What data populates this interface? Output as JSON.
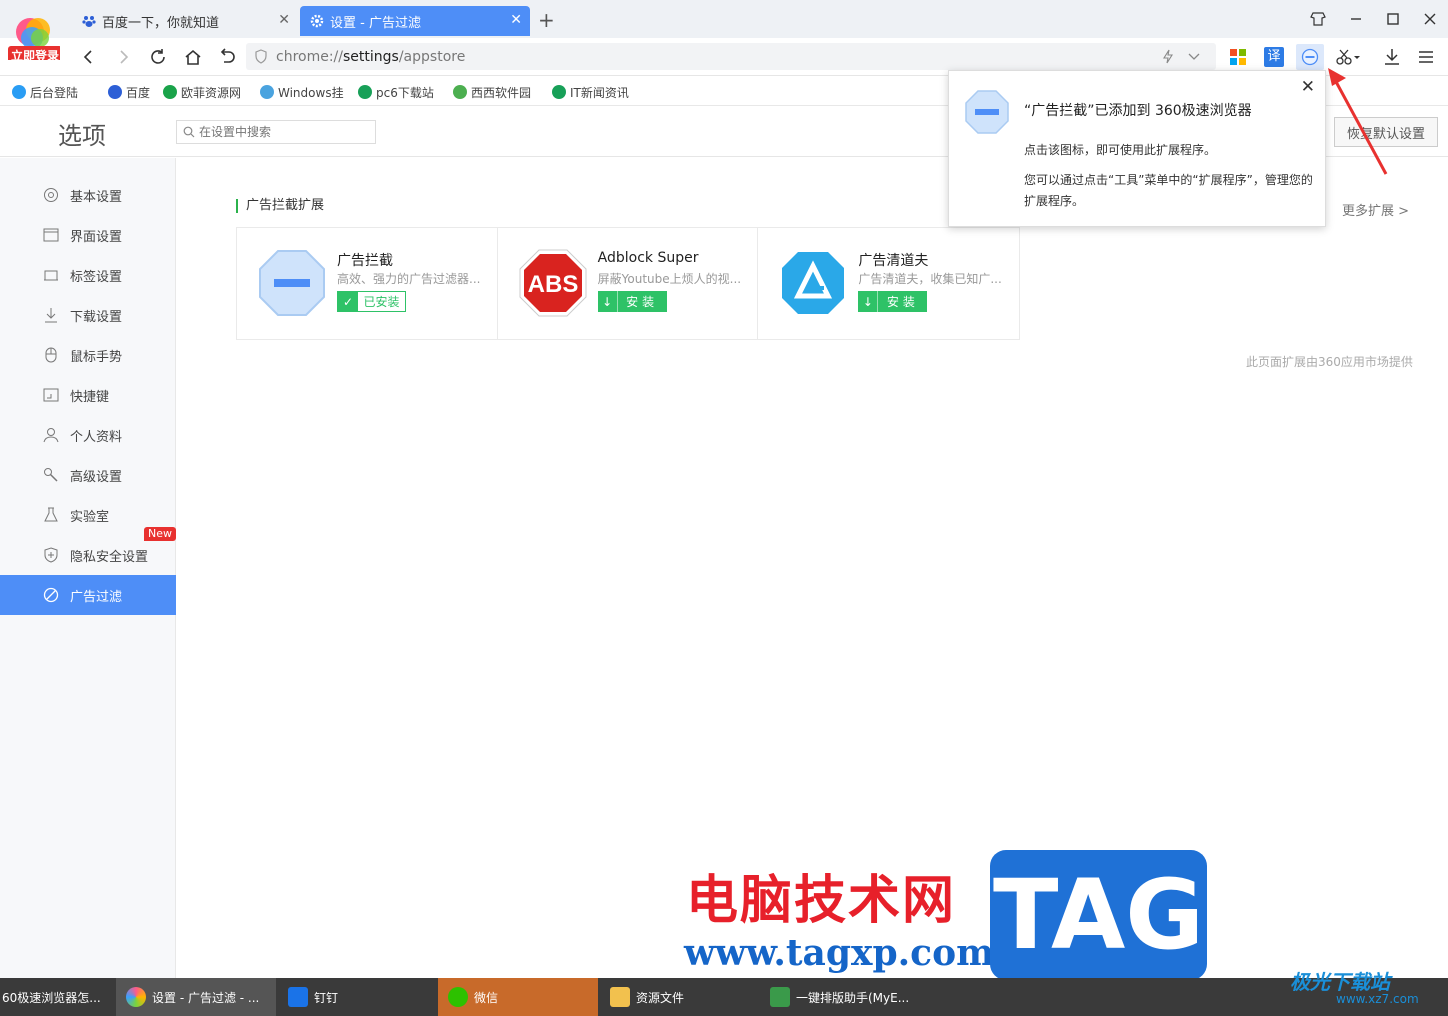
{
  "browser": {
    "login_badge": "立即登录",
    "tabs": [
      {
        "label": "百度一下，你就知道"
      },
      {
        "label": "设置 - 广告过滤"
      }
    ],
    "address": {
      "scheme": "chrome://",
      "host": "settings",
      "path": "/appstore"
    },
    "translate_label": "译"
  },
  "bookmarks": [
    {
      "label": "后台登陆"
    },
    {
      "label": "百度"
    },
    {
      "label": "欧菲资源网"
    },
    {
      "label": "Windows挂"
    },
    {
      "label": "pc6下载站"
    },
    {
      "label": "西西软件园"
    },
    {
      "label": "IT新闻资讯"
    }
  ],
  "settings": {
    "title": "选项",
    "search_placeholder": "在设置中搜索",
    "restore_label": "恢复默认设置",
    "new_badge": "New",
    "sidebar": [
      {
        "label": "基本设置",
        "icon": "gear-icon"
      },
      {
        "label": "界面设置",
        "icon": "window-icon"
      },
      {
        "label": "标签设置",
        "icon": "tab-icon"
      },
      {
        "label": "下载设置",
        "icon": "download-icon"
      },
      {
        "label": "鼠标手势",
        "icon": "mouse-icon"
      },
      {
        "label": "快捷键",
        "icon": "keyboard-icon"
      },
      {
        "label": "个人资料",
        "icon": "user-icon"
      },
      {
        "label": "高级设置",
        "icon": "wrench-icon"
      },
      {
        "label": "实验室",
        "icon": "flask-icon"
      },
      {
        "label": "隐私安全设置",
        "icon": "shield-icon"
      },
      {
        "label": "广告过滤",
        "icon": "block-icon",
        "active": true
      }
    ]
  },
  "main": {
    "section_title": "广告拦截扩展",
    "more_label": "更多扩展 >",
    "provider_note": "此页面扩展由360应用市场提供",
    "extensions": [
      {
        "name": "广告拦截",
        "desc": "高效、强力的广告过滤器...",
        "button": "已安装",
        "installed": true,
        "icon": "adblock-stop-icon"
      },
      {
        "name": "Adblock Super",
        "desc": "屏蔽Youtube上烦人的视...",
        "button": "安装",
        "installed": false,
        "icon": "abs-icon",
        "icon_text": "ABS"
      },
      {
        "name": "广告清道夫",
        "desc": "广告清道夫，收集已知广...",
        "button": "安装",
        "installed": false,
        "icon": "adsweeper-icon"
      }
    ]
  },
  "popup": {
    "title": "“广告拦截”已添加到 360极速浏览器",
    "line1": "点击该图标，即可使用此扩展程序。",
    "line2": "您可以通过点击“工具”菜单中的“扩展程序”，管理您的扩展程序。"
  },
  "watermark": {
    "site_name": "电脑技术网",
    "url": "www.tagxp.com",
    "tag": "TAG",
    "corner_logo": "极光下载站",
    "corner_url": "www.xz7.com"
  },
  "taskbar": [
    {
      "label": "60极速浏览器怎..."
    },
    {
      "label": "设置 - 广告过滤 - ..."
    },
    {
      "label": "钉钉"
    },
    {
      "label": "微信"
    },
    {
      "label": "资源文件"
    },
    {
      "label": "一键排版助手(MyE..."
    }
  ],
  "colors": {
    "accent": "#4e8ef7",
    "install_green": "#2ec267",
    "badge_red": "#e8312f"
  }
}
